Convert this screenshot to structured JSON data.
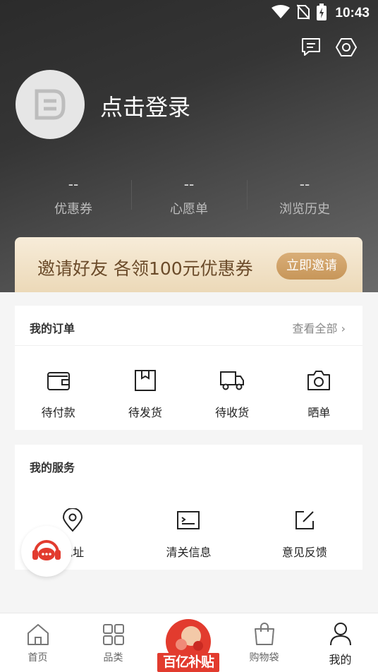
{
  "status_bar": {
    "time": "10:43"
  },
  "profile": {
    "login_text": "点击登录"
  },
  "stats": [
    {
      "value": "--",
      "label": "优惠券"
    },
    {
      "value": "--",
      "label": "心愿单"
    },
    {
      "value": "--",
      "label": "浏览历史"
    }
  ],
  "invite": {
    "text": "邀请好友 各领100元优惠券",
    "button": "立即邀请"
  },
  "orders": {
    "title": "我的订单",
    "more": "查看全部",
    "items": [
      {
        "label": "待付款",
        "icon": "wallet-icon"
      },
      {
        "label": "待发货",
        "icon": "box-icon"
      },
      {
        "label": "待收货",
        "icon": "truck-icon"
      },
      {
        "label": "晒单",
        "icon": "camera-icon"
      }
    ]
  },
  "services": {
    "title": "我的服务",
    "items": [
      {
        "label": "地址",
        "icon": "location-icon"
      },
      {
        "label": "清关信息",
        "icon": "id-card-icon"
      },
      {
        "label": "意见反馈",
        "icon": "edit-icon"
      }
    ]
  },
  "tabbar": {
    "items": [
      {
        "label": "首页",
        "icon": "home-icon"
      },
      {
        "label": "品类",
        "icon": "grid-icon"
      },
      {
        "label": "百亿补贴",
        "icon": "promo-icon"
      },
      {
        "label": "购物袋",
        "icon": "bag-icon"
      },
      {
        "label": "我的",
        "icon": "user-icon"
      }
    ],
    "active": "我的"
  },
  "colors": {
    "header_dark": "#2b2b2b",
    "invite_bg": "#f0dfc2",
    "invite_btn": "#d1a46a",
    "promo_red": "#e23b2e"
  }
}
